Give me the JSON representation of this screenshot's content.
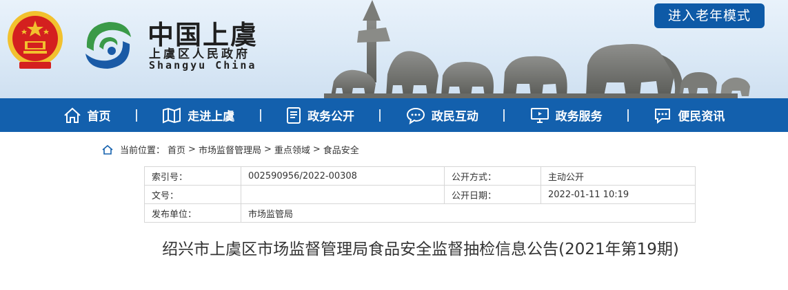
{
  "header": {
    "site_title": "中国上虞",
    "site_subtitle": "上虞区人民政府",
    "site_english": "Shangyu China",
    "elder_mode_label": "进入老年模式"
  },
  "nav": {
    "items": [
      {
        "label": "首页",
        "icon": "home-icon"
      },
      {
        "label": "走进上虞",
        "icon": "map-icon"
      },
      {
        "label": "政务公开",
        "icon": "document-icon"
      },
      {
        "label": "政民互动",
        "icon": "chat-icon"
      },
      {
        "label": "政务服务",
        "icon": "monitor-icon"
      },
      {
        "label": "便民资讯",
        "icon": "message-icon"
      }
    ]
  },
  "breadcrumb": {
    "prefix": "当前位置：",
    "items": [
      "首页",
      "市场监督管理局",
      "重点领域",
      "食品安全"
    ],
    "separator": ">"
  },
  "meta": {
    "index_label": "索引号：",
    "index_value": "002590956/2022-00308",
    "publish_mode_label": "公开方式：",
    "publish_mode_value": "主动公开",
    "doc_no_label": "文号：",
    "doc_no_value": "",
    "publish_date_label": "公开日期：",
    "publish_date_value": "2022-01-11 10:19",
    "issuer_label": "发布单位：",
    "issuer_value": "市场监管局"
  },
  "article": {
    "title": "绍兴市上虞区市场监督管理局食品安全监督抽检信息公告(2021年第19期)"
  },
  "colors": {
    "nav_bg": "#1360ad",
    "elder_btn_bg": "#0e5aa7",
    "logo_green": "#3a9a48",
    "logo_blue": "#1a5aa6",
    "emblem_red": "#d4201f",
    "emblem_gold": "#f2c12e"
  }
}
